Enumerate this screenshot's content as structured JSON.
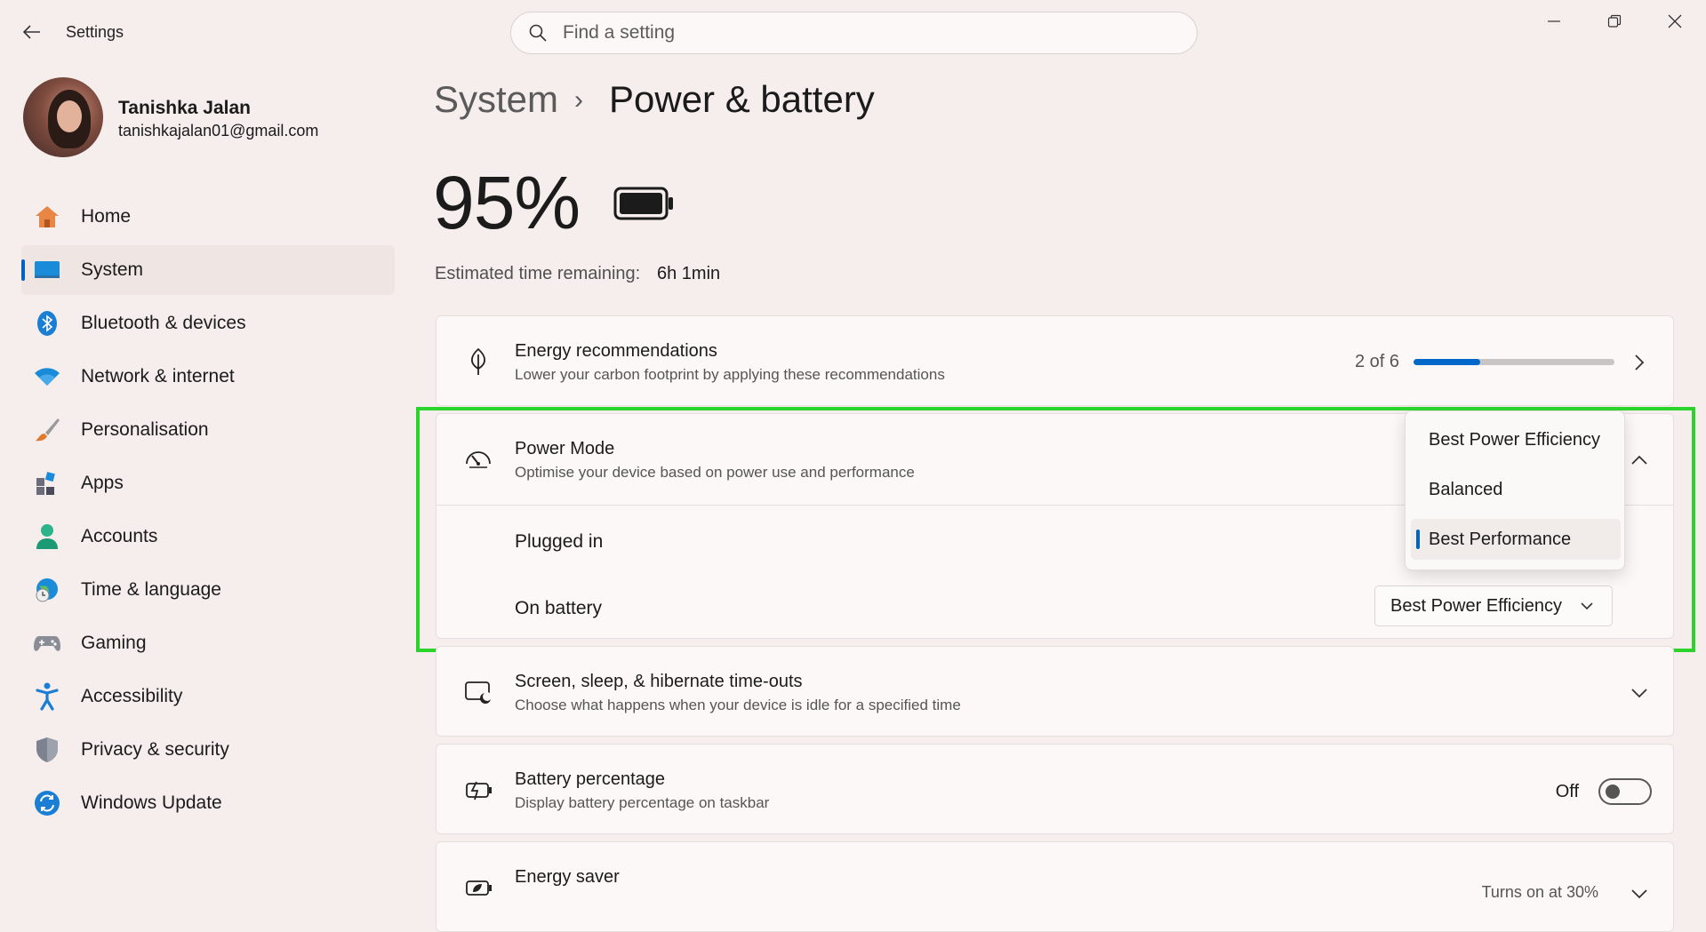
{
  "app": {
    "title": "Settings"
  },
  "search": {
    "placeholder": "Find a setting"
  },
  "user": {
    "name": "Tanishka Jalan",
    "email": "tanishkajalan01@gmail.com"
  },
  "sidebar": {
    "items": [
      {
        "label": "Home",
        "icon": "home-icon"
      },
      {
        "label": "System",
        "icon": "system-icon",
        "active": true
      },
      {
        "label": "Bluetooth & devices",
        "icon": "bluetooth-icon"
      },
      {
        "label": "Network & internet",
        "icon": "wifi-icon"
      },
      {
        "label": "Personalisation",
        "icon": "brush-icon"
      },
      {
        "label": "Apps",
        "icon": "apps-icon"
      },
      {
        "label": "Accounts",
        "icon": "accounts-icon"
      },
      {
        "label": "Time & language",
        "icon": "globe-clock-icon"
      },
      {
        "label": "Gaming",
        "icon": "gamepad-icon"
      },
      {
        "label": "Accessibility",
        "icon": "accessibility-icon"
      },
      {
        "label": "Privacy & security",
        "icon": "shield-icon"
      },
      {
        "label": "Windows Update",
        "icon": "update-icon"
      }
    ]
  },
  "breadcrumb": {
    "parent": "System",
    "separator": "›",
    "current": "Power & battery"
  },
  "battery": {
    "percent_text": "95%",
    "estimated_label": "Estimated time remaining:",
    "estimated_value": "6h 1min"
  },
  "energy_recommendations": {
    "title": "Energy recommendations",
    "description": "Lower your carbon footprint by applying these recommendations",
    "progress_text": "2 of 6",
    "progress_fraction": 0.333
  },
  "power_mode": {
    "title": "Power Mode",
    "description": "Optimise your device based on power use and performance",
    "plugged_in_label": "Plugged in",
    "on_battery_label": "On battery",
    "on_battery_value": "Best Power Efficiency",
    "options": [
      "Best Power Efficiency",
      "Balanced",
      "Best Performance"
    ],
    "selected_option": "Best Performance"
  },
  "screen_sleep": {
    "title": "Screen, sleep, & hibernate time-outs",
    "description": "Choose what happens when your device is idle for a specified time"
  },
  "battery_percentage": {
    "title": "Battery percentage",
    "description": "Display battery percentage on taskbar",
    "toggle_label": "Off"
  },
  "energy_saver": {
    "title": "Energy saver",
    "status": "Turns on at 30%"
  },
  "colors": {
    "accent": "#0063c4",
    "highlight": "#2bd42b",
    "background": "#f6eeec"
  }
}
